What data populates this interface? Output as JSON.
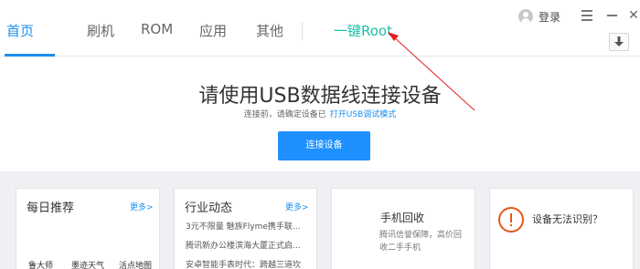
{
  "nav": {
    "tabs": [
      {
        "label": "首页",
        "active": true
      },
      {
        "label": "刷机",
        "active": false
      },
      {
        "label": "ROM",
        "active": false
      },
      {
        "label": "应用",
        "active": false
      },
      {
        "label": "其他",
        "active": false
      }
    ],
    "root_label": "一键Root"
  },
  "header": {
    "login_label": "登录"
  },
  "hero": {
    "title": "请使用USB数据线连接设备",
    "subtitle": "连接前，请确定设备已",
    "subtitle_link": "打开USB调试模式",
    "connect_button": "连接设备"
  },
  "cards": {
    "daily": {
      "title": "每日推荐",
      "more": "更多>",
      "apps": [
        "鲁大师",
        "墨迹天气",
        "活点地图"
      ]
    },
    "industry": {
      "title": "行业动态",
      "more": "更多>",
      "news": [
        "3元不限量 魅族Flyme携手联...",
        "腾讯新办公楼滨海大厦正式启...",
        "安卓智能手表时代：跨越三道坎"
      ]
    },
    "recycle": {
      "title": "手机回收",
      "desc": "腾讯信誉保障，高价回收二手手机"
    },
    "device": {
      "title": "设备无法识别？"
    }
  },
  "colors": {
    "accent": "#1a8ff0",
    "root_link": "#1bbfa8",
    "annotation_arrow": "#e02020",
    "warning": "#e8551e"
  }
}
